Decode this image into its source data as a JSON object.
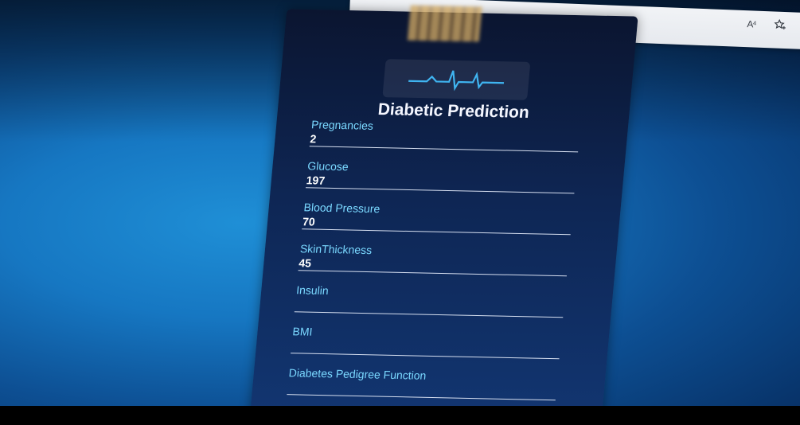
{
  "browser": {
    "icons": [
      "read-aloud-icon",
      "favorite-icon",
      "extensions-icon"
    ],
    "read_aloud_glyph": "A⁴"
  },
  "form": {
    "title": "Diabetic Prediction",
    "logo_icon": "heartbeat-icon",
    "fields": [
      {
        "label": "Pregnancies",
        "value": "2"
      },
      {
        "label": "Glucose",
        "value": "197"
      },
      {
        "label": "Blood Pressure",
        "value": "70"
      },
      {
        "label": "SkinThickness",
        "value": "45"
      },
      {
        "label": "Insulin",
        "value": ""
      },
      {
        "label": "BMI",
        "value": ""
      },
      {
        "label": "Diabetes Pedigree Function",
        "value": ""
      }
    ]
  },
  "colors": {
    "accent": "#7ad8ff",
    "card_bg": "#0e2654",
    "page_bg": "#1677c2"
  }
}
